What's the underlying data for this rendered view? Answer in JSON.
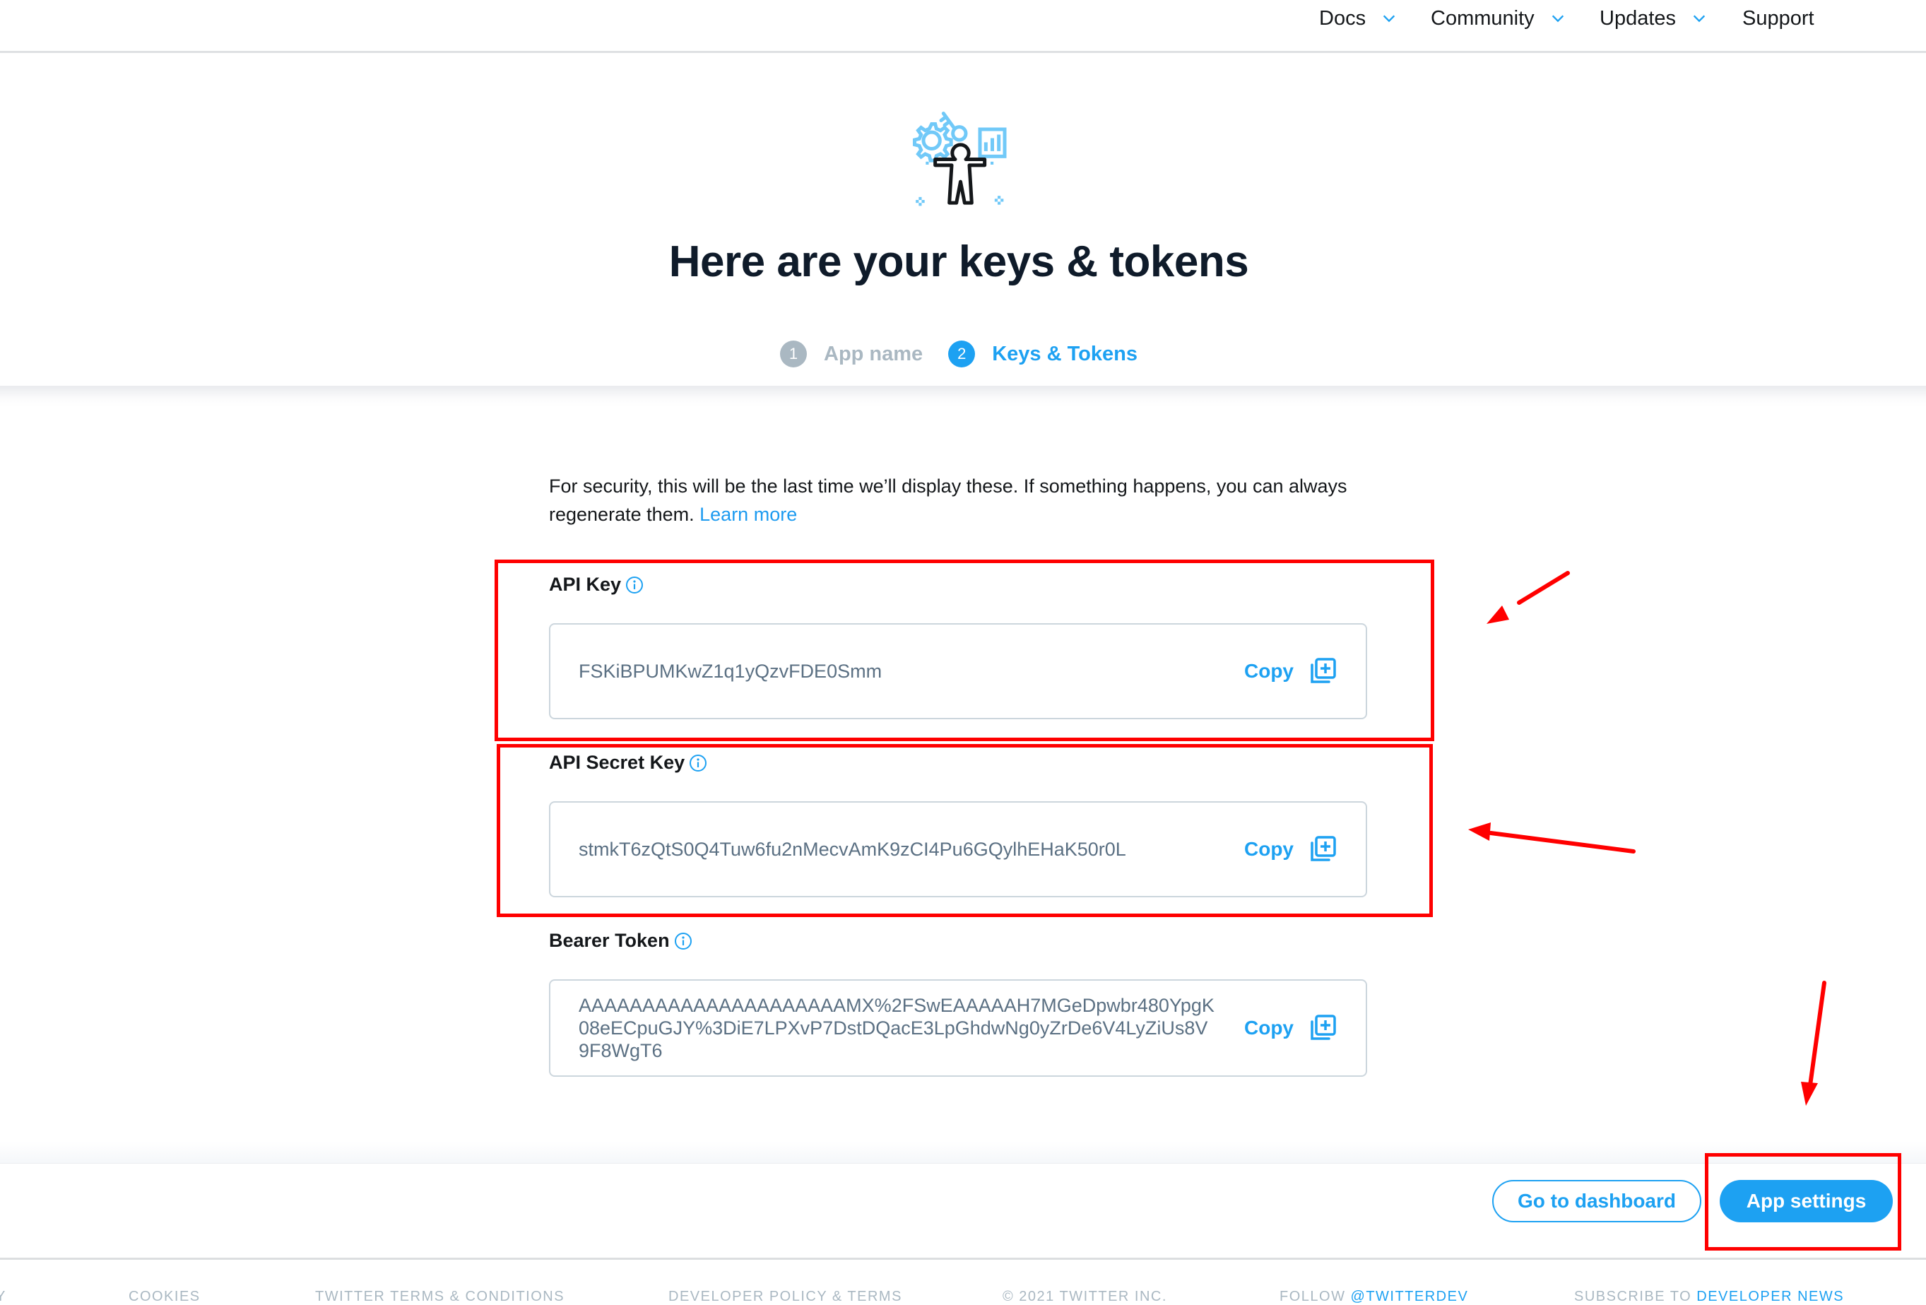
{
  "nav": {
    "items": [
      {
        "label": "Docs",
        "has_dropdown": true,
        "icon": "chevron-down-icon"
      },
      {
        "label": "Community",
        "has_dropdown": true,
        "icon": "chevron-down-icon"
      },
      {
        "label": "Updates",
        "has_dropdown": true,
        "icon": "chevron-down-icon"
      },
      {
        "label": "Support",
        "has_dropdown": false
      }
    ]
  },
  "hero": {
    "illustration": "developer-keys-illustration",
    "title": "Here are your keys & tokens",
    "steps": [
      {
        "number": "1",
        "label": "App name",
        "state": "completed"
      },
      {
        "number": "2",
        "label": "Keys & Tokens",
        "state": "active"
      }
    ]
  },
  "content": {
    "intro_text": "For security, this will be the last time we’ll display these. If something happens, you can always regenerate them.",
    "learn_more_label": "Learn more",
    "fields": [
      {
        "label": "API Key",
        "value": "FSKiBPUMKwZ1q1yQzvFDE0Smm",
        "copy_label": "Copy",
        "highlighted": true
      },
      {
        "label": "API Secret Key",
        "value": "stmkT6zQtS0Q4Tuw6fu2nMecvAmK9zCI4Pu6GQylhEHaK50r0L",
        "copy_label": "Copy",
        "highlighted": true
      },
      {
        "label": "Bearer Token",
        "value": "AAAAAAAAAAAAAAAAAAAAAMX%2FSwEAAAAAH7MGeDpwbr480YpgK08eECpuGJY%3DiE7LPXvP7DstDQacE3LpGhdwNg0yZrDe6V4LyZiUs8V9F8WgT6",
        "copy_label": "Copy",
        "highlighted": false
      }
    ]
  },
  "actions": {
    "dashboard_label": "Go to dashboard",
    "settings_label": "App settings"
  },
  "footer": {
    "links": [
      {
        "text": "Y"
      },
      {
        "text": "COOKIES"
      },
      {
        "text": "TWITTER TERMS & CONDITIONS"
      },
      {
        "text": "DEVELOPER POLICY & TERMS"
      },
      {
        "text": "© 2021 TWITTER INC."
      },
      {
        "prefix": "FOLLOW ",
        "highlight": "@TWITTERDEV"
      },
      {
        "prefix": "SUBSCRIBE TO ",
        "highlight": "DEVELOPER NEWS"
      }
    ]
  },
  "annotations": {
    "color": "#ff0000",
    "boxes": [
      "api-key-field",
      "api-secret-key-field",
      "app-settings-button"
    ],
    "arrows": [
      "pointing-to-api-key",
      "pointing-to-api-secret-key",
      "pointing-to-app-settings"
    ]
  },
  "colors": {
    "accent": "#1da1f2",
    "title": "#0f1b2a",
    "muted": "#aab8c2",
    "key_text": "#5b7083",
    "annotation": "#ff0000"
  }
}
